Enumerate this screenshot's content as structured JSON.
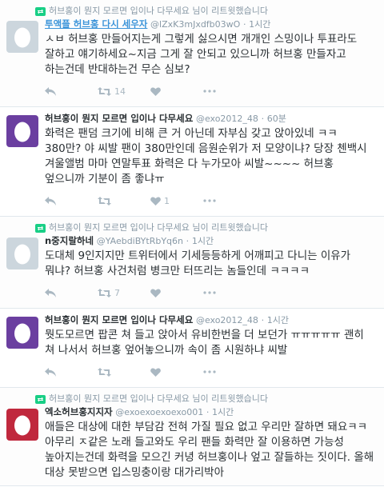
{
  "tweets": [
    {
      "retweet_label": "허브홍이 뭔지 모르면 입이나 다무세요 님이 리트윗했습니다",
      "name": "투액플 허브홍 다시 세우자",
      "handle": "@lZxK3mJxdfb03wO",
      "dot": "·",
      "time": "1시간",
      "text": "ㅅㅂ 허브홍 만들어지는게 그렇게 싫으시면 개개인 스밍이나 투표라도 잘하고 얘기하세요~지금 그게 잘 안되고 있으니까 허브홍 만들자고 하는건데 반대하는건 무슨 심보?",
      "retweets": "14",
      "likes": "",
      "avatar": "gray"
    },
    {
      "retweet_label": "",
      "name": "허브홍이 뭔지 모르면 입이나 다무세요",
      "handle": "@exo2012_48",
      "dot": "·",
      "time": "60분",
      "text": "화력은 팬덤 크기에 비해 큰 거 아닌데 자부심 갖고 앉아있네 ㅋㅋ 380만? 야 씨발 팬이 380만인데 음원순위가 저 모양이냐? 당장 첸백시 겨울앨범 마마 연말투표 화력은 다 누가모아 씨발~~~~ 허브홍 엎으니까 기분이 좀 좋냐ㅠ",
      "retweets": "",
      "likes": "1",
      "avatar": "purple"
    },
    {
      "retweet_label": "허브홍이 뭔지 모르면 입이나 다무세요 님이 리트윗했습니다",
      "name": "n중지랄하네",
      "handle": "@YAebdiBYtRbYq6n",
      "dot": "·",
      "time": "1시간",
      "text": "도대체 9인지지만 트위터에서 기세등등하게 어깨피고 다니는 이유가 뭐냐? 허브홍 사건처럼 병크만 터뜨리는 놈들인데 ㅋㅋㅋㅋ",
      "retweets": "7",
      "likes": "",
      "avatar": "gray"
    },
    {
      "retweet_label": "",
      "name": "허브홍이 뭔지 모르면 입이나 다무세요",
      "handle": "@exo2012_48",
      "dot": "·",
      "time": "1시간",
      "text": "뭣도모르면 팝콘 쳐 들고 앉아서 유비한번을 더 보던가 ㅠㅠㅠㅠㅠ 괜히 쳐 나서서 허브홍 엎어놓으니까 속이 좀 시원하냐 씨발",
      "retweets": "",
      "likes": "",
      "avatar": "purple"
    },
    {
      "retweet_label": "허브홍이 뭔지 모르면 입이나 다무세요 님이 리트윗했습니다",
      "name": "엑소허브홍지지자",
      "handle": "@exoexoexoexo001",
      "dot": "·",
      "time": "1시간",
      "text": "애들은 대상에 대한 부담감 전혀 가질 필요 없고 우리만 잘하면 돼요ㅋㅋ 아무리 ㅈ같은 노래 들고와도 우리 팬들 화력만 잘 이용하면 가능성 높아지는건데 화력을 모으긴 커녕 허브홍이나 엎고 잘들하는 짓이다. 올해 대상 못받으면 입스밍충이랑 대가리박아",
      "retweets": "",
      "likes": "",
      "avatar": "red"
    }
  ]
}
